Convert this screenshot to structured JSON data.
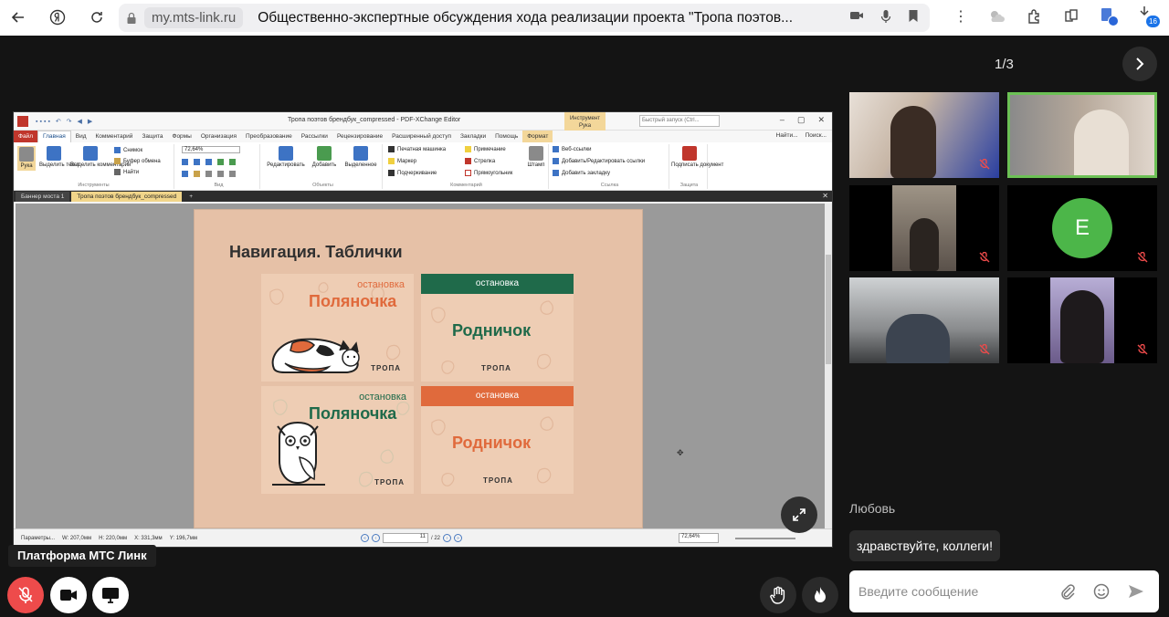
{
  "browser": {
    "domain": "my.mts-link.ru",
    "tab_title": "Общественно-экспертные обсуждения хода реализации проекта \"Тропа поэтов...",
    "extension_badge": "16"
  },
  "pager": {
    "counter": "1/3"
  },
  "editor": {
    "window_title": "Тропа поэтов брендбук_compressed - PDF-XChange Editor",
    "search_placeholder": "Быстрый запуск (Ctrl...",
    "context_tab": "Инструмент Рука",
    "menu_tabs": [
      "Файл",
      "Главная",
      "Вид",
      "Комментарий",
      "Защита",
      "Формы",
      "Организация",
      "Преобразование",
      "Рассылки",
      "Рецензирование",
      "Расширенный доступ",
      "Закладки",
      "Помощь",
      "Формат"
    ],
    "menu_right": [
      "Найти...",
      "Поиск..."
    ],
    "ribbon": {
      "tools": [
        "Рука",
        "Выделить текст",
        "Выделить комментарии"
      ],
      "tools_small": [
        "Снимок",
        "Буфер обмена",
        "Найти"
      ],
      "zoom": "72,64%",
      "objects": [
        "Редактировать",
        "Добавить",
        "Выделенное"
      ],
      "comments": [
        "Печатная машинка",
        "Маркер",
        "Подчеркивание",
        "Примечание",
        "Стрелка",
        "Прямоугольник"
      ],
      "stamp": "Штамп",
      "links": [
        "Веб-ссылки",
        "Добавить/Редактировать ссылки",
        "Добавить закладку"
      ],
      "sign": "Подписать документ",
      "group_labels": [
        "Инструменты",
        "Вид",
        "Объекты",
        "Комментарий",
        "Ссылка",
        "Защита"
      ]
    },
    "doc_tabs": [
      "Баннер моста 1",
      "Тропа поэтов брендбук_compressed"
    ],
    "status": {
      "params": "Параметры...",
      "w": "W: 207,0мм",
      "h": "H: 220,0мм",
      "x": "X: 331,3мм",
      "y": "Y: 196,7мм",
      "page": "11",
      "total": "/ 22",
      "zoom": "72,64%"
    }
  },
  "slide": {
    "title": "Навигация. Таблички",
    "cards": [
      {
        "stop": "остановка",
        "name": "Поляночка",
        "brand": "ТРОПА"
      },
      {
        "stop": "остановка",
        "name": "Родничок",
        "brand": "ТРОПА"
      },
      {
        "stop": "остановка",
        "name": "Поляночка",
        "brand": "ТРОПА"
      },
      {
        "stop": "остановка",
        "name": "Родничок",
        "brand": "ТРОПА"
      }
    ]
  },
  "participants": [
    {
      "avatar": ""
    },
    {
      "avatar": ""
    },
    {
      "avatar": ""
    },
    {
      "avatar": "E"
    },
    {
      "avatar": ""
    },
    {
      "avatar": ""
    }
  ],
  "chat": {
    "author": "Любовь",
    "message": "здравствуйте, коллеги!",
    "input_placeholder": "Введите сообщение"
  },
  "platform_label": "Платформа МТС Линк",
  "colors": {
    "accent_green": "#4cb649",
    "mic_off_red": "#ee4b4b",
    "card_green": "#1f6a4a",
    "card_orange": "#e06a3c"
  }
}
